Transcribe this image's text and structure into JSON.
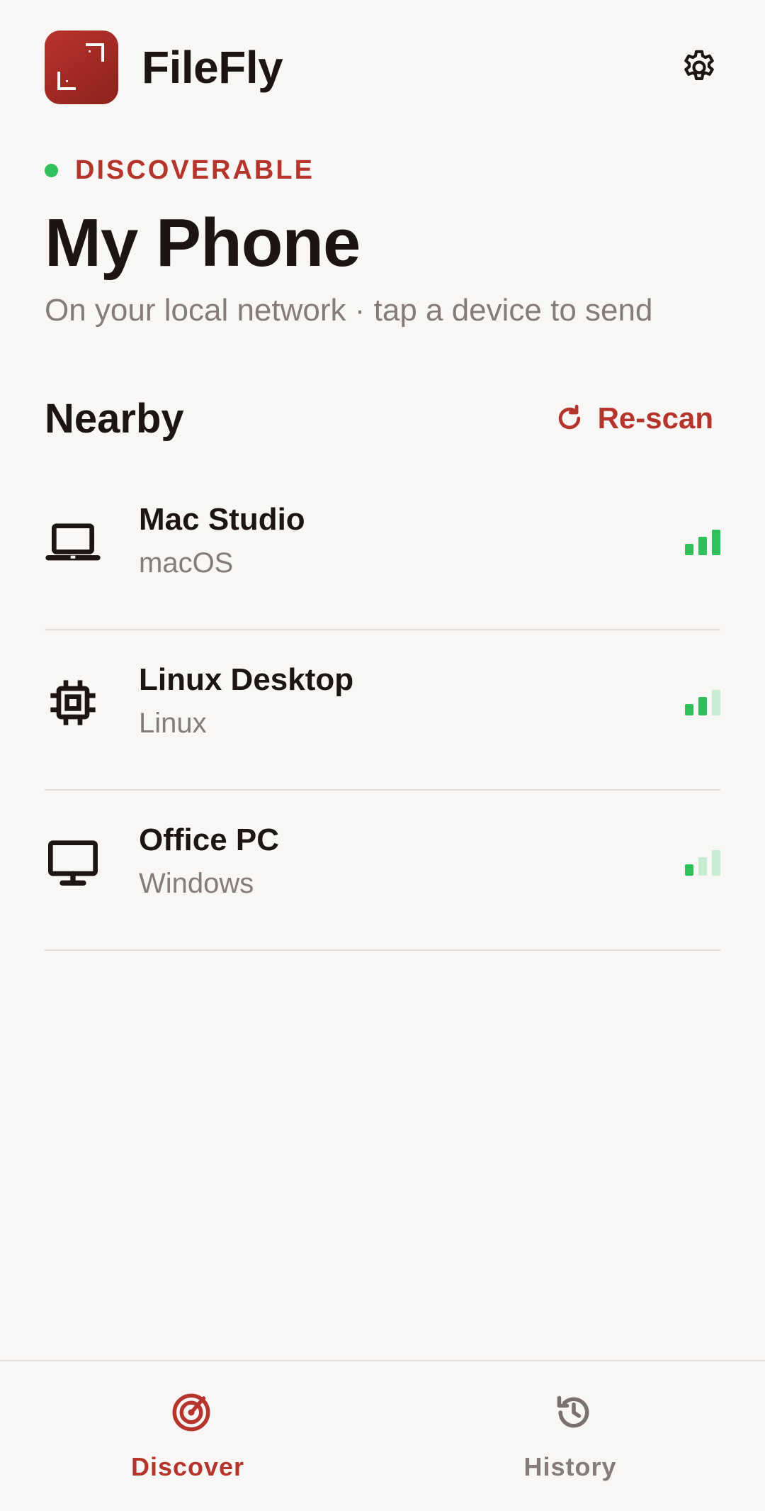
{
  "app": {
    "title": "FileFly",
    "logo_icon": "app-logo",
    "settings_icon": "gear-icon"
  },
  "status": {
    "label": "DISCOVERABLE",
    "dot_color": "#2fbf5b"
  },
  "device": {
    "name": "My Phone",
    "subtitle": "On your local network · tap a device to send"
  },
  "nearby": {
    "title": "Nearby",
    "rescan_label": "Re-scan",
    "rescan_icon": "refresh-icon"
  },
  "devices": [
    {
      "name": "Mac Studio",
      "os": "macOS",
      "icon": "laptop-icon",
      "signal": 3
    },
    {
      "name": "Linux Desktop",
      "os": "Linux",
      "icon": "chip-icon",
      "signal": 2
    },
    {
      "name": "Office PC",
      "os": "Windows",
      "icon": "monitor-icon",
      "signal": 1
    }
  ],
  "nav": [
    {
      "label": "Discover",
      "icon": "radar-icon",
      "active": true
    },
    {
      "label": "History",
      "icon": "history-icon",
      "active": false
    }
  ],
  "colors": {
    "accent": "#b5352c",
    "signal_on": "#2fbf5b",
    "signal_off": "#c6ecd1"
  }
}
